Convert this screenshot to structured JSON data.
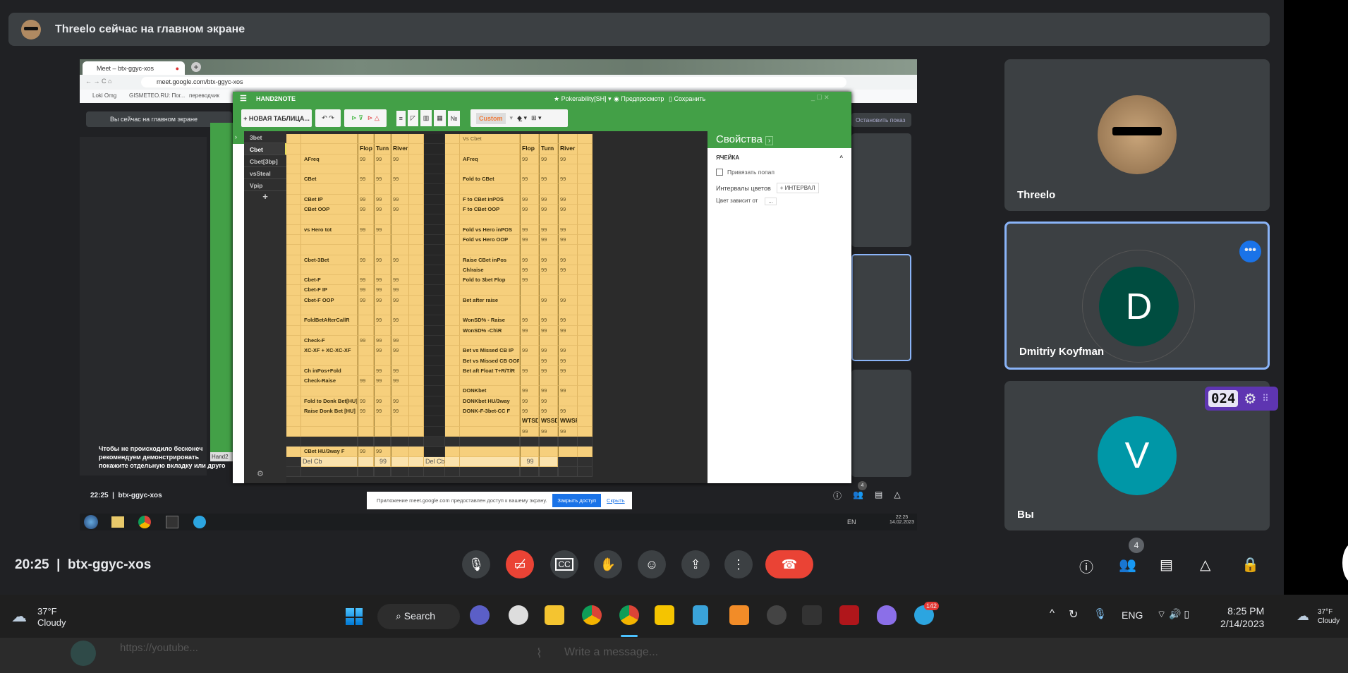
{
  "banner": {
    "text": "Threelo сейчас на главном экране"
  },
  "shared": {
    "chrome": {
      "tab": "Meet – btx-ggyc-xos",
      "url": "meet.google.com/btx-ggyc-xos",
      "bookmarks": [
        "Loki Omg",
        "GISMETEO.RU: Пог...",
        "переводчик"
      ]
    },
    "meet_inner": {
      "presenting": "Вы сейчас на главном экране",
      "stop": "Остановить показ",
      "time": "22:25",
      "code": "btx-ggyc-xos",
      "badge": "4",
      "blurred_text": [
        "Чтобы не происходило бесконеч",
        "рекомендуем демонстрировать",
        "покажите отдельную вкладку или друго"
      ],
      "hand2_tab": "Hand2"
    },
    "notice": {
      "text": "Приложение meet.google.com предоставлен доступ к вашему экрану.",
      "button": "Закрыть доступ",
      "link": "Скрыть"
    },
    "win7": {
      "lang": "EN",
      "time": "22:25",
      "date": "14.02.2023"
    }
  },
  "h2n": {
    "title": "HAND2NOTE",
    "profile": "Pokerability[SH]",
    "preview": "Предпросмотр",
    "save": "Сохранить",
    "new_table": "+ НОВАЯ ТАБЛИЦА...",
    "style": "Custom",
    "tabs": [
      "3bet",
      "Cbet",
      "Cbet[3bp]",
      "vsSteal",
      "Vpip"
    ],
    "active_tab": "Cbet",
    "add_tab": "+",
    "properties": {
      "title": "Свойства",
      "section": "ЯЧЕЙКА",
      "bind_popup": "Привязать попап",
      "intervals": "Интервалы цветов",
      "add_interval": "+ ИНТЕРВАЛ",
      "color_dep": "Цвет зависит от",
      "color_dep_btn": "..."
    },
    "sheet": {
      "rows": [
        {
          "t": "n",
          "v": [
            "",
            "",
            "",
            "",
            "Vs Cbet",
            "",
            "",
            ""
          ]
        },
        {
          "t": "h",
          "v": [
            "",
            "Flop",
            "Turn",
            "River",
            "",
            "Flop",
            "Turn",
            "River"
          ]
        },
        {
          "t": "n",
          "v": [
            "AFreq",
            "99",
            "99",
            "99",
            "AFreq",
            "99",
            "99",
            "99"
          ]
        },
        {
          "t": "n",
          "v": [
            "",
            "",
            "",
            "",
            "",
            "",
            "",
            ""
          ]
        },
        {
          "t": "n",
          "v": [
            "CBet",
            "99",
            "99",
            "99",
            "Fold to CBet",
            "99",
            "99",
            "99"
          ]
        },
        {
          "t": "n",
          "v": [
            "",
            "",
            "",
            "",
            "",
            "",
            "",
            ""
          ]
        },
        {
          "t": "n",
          "v": [
            "CBet IP",
            "99",
            "99",
            "99",
            "F to CBet inPOS",
            "99",
            "99",
            "99"
          ]
        },
        {
          "t": "n",
          "v": [
            "CBet OOP",
            "99",
            "99",
            "99",
            "F to CBet OOP",
            "99",
            "99",
            "99"
          ]
        },
        {
          "t": "n",
          "v": [
            "",
            "",
            "",
            "",
            "",
            "",
            "",
            ""
          ]
        },
        {
          "t": "n",
          "v": [
            "vs Hero tot",
            "99",
            "99",
            "",
            "Fold vs Hero inPOS",
            "99",
            "99",
            "99"
          ]
        },
        {
          "t": "n",
          "v": [
            "",
            "",
            "",
            "",
            "Fold vs Hero OOP",
            "99",
            "99",
            "99"
          ]
        },
        {
          "t": "n",
          "v": [
            "",
            "",
            "",
            "",
            "",
            "",
            "",
            ""
          ]
        },
        {
          "t": "n",
          "v": [
            "Cbet-3Bet",
            "99",
            "99",
            "99",
            "Raise CBet inPos",
            "99",
            "99",
            "99"
          ]
        },
        {
          "t": "n",
          "v": [
            "",
            "",
            "",
            "",
            "Ch/raise",
            "99",
            "99",
            "99"
          ]
        },
        {
          "t": "n",
          "v": [
            "Cbet-F",
            "99",
            "99",
            "99",
            "Fold to 3bet Flop",
            "99",
            "",
            ""
          ]
        },
        {
          "t": "n",
          "v": [
            "Cbet-F IP",
            "99",
            "99",
            "99",
            "",
            "",
            "",
            ""
          ]
        },
        {
          "t": "n",
          "v": [
            "Cbet-F OOP",
            "99",
            "99",
            "99",
            "Bet after raise",
            "",
            "99",
            "99"
          ]
        },
        {
          "t": "n",
          "v": [
            "",
            "",
            "",
            "",
            "",
            "",
            "",
            ""
          ]
        },
        {
          "t": "n",
          "v": [
            "FoldBetAfterCallR",
            "",
            "99",
            "99",
            "WonSD% - Raise",
            "99",
            "99",
            "99"
          ]
        },
        {
          "t": "n",
          "v": [
            "",
            "",
            "",
            "",
            "WonSD% -Ch\\R",
            "99",
            "99",
            "99"
          ]
        },
        {
          "t": "n",
          "v": [
            "Check-F",
            "99",
            "99",
            "99",
            "",
            "",
            "",
            ""
          ]
        },
        {
          "t": "n",
          "v": [
            "XC-XF + XC-XC-XF",
            "",
            "99",
            "99",
            "Bet vs Missed CB IP",
            "99",
            "99",
            "99"
          ]
        },
        {
          "t": "n",
          "v": [
            "",
            "",
            "",
            "",
            "Bet vs Missed CB OOP",
            "",
            "99",
            "99"
          ]
        },
        {
          "t": "n",
          "v": [
            "Ch inPos+Fold",
            "",
            "99",
            "99",
            "Bet aft Float T+R/T/R",
            "99",
            "99",
            "99"
          ]
        },
        {
          "t": "n",
          "v": [
            "Check-Raise",
            "99",
            "99",
            "99",
            "",
            "",
            "",
            ""
          ]
        },
        {
          "t": "n",
          "v": [
            "",
            "",
            "",
            "",
            "DONKbet",
            "99",
            "99",
            "99"
          ]
        },
        {
          "t": "n",
          "v": [
            "Fold to Donk Bet[HU]",
            "99",
            "99",
            "99",
            "DONKbet HU/3way",
            "99",
            "99",
            ""
          ]
        },
        {
          "t": "n",
          "v": [
            "Raise Donk Bet [HU]",
            "99",
            "99",
            "99",
            "DONK-F-3bet-CC F",
            "99",
            "99",
            "99"
          ]
        },
        {
          "t": "h",
          "v": [
            "",
            "",
            "",
            "",
            "",
            "WTSD",
            "WSSD",
            "WWSF"
          ]
        },
        {
          "t": "n",
          "v": [
            "",
            "",
            "",
            "",
            "",
            "99",
            "99",
            "99"
          ]
        },
        {
          "t": "d",
          "v": [
            "",
            "",
            "",
            "",
            "",
            "",
            "",
            ""
          ]
        },
        {
          "t": "n",
          "v": [
            "CBet HU/3way F",
            "99",
            "99",
            "",
            "",
            "",
            "",
            ""
          ]
        },
        {
          "t": "x",
          "v": [
            "Del Cb",
            "",
            "99",
            "",
            "Del Cb",
            "99",
            "",
            ""
          ]
        },
        {
          "t": "d",
          "v": [
            "",
            "",
            "",
            "",
            "",
            "",
            "",
            ""
          ]
        }
      ]
    }
  },
  "participants": [
    {
      "name": "Threelo"
    },
    {
      "name": "Dmitriy Koyfman",
      "initial": "D",
      "color": "#004d40"
    },
    {
      "name": "Вы",
      "initial": "V",
      "color": "#0097a7"
    }
  ],
  "timer": {
    "value": "024"
  },
  "controls": {
    "time": "20:25",
    "code": "btx-ggyc-xos",
    "people_count": "4",
    "buttons": [
      "mic-icon",
      "camera-off-icon",
      "captions-icon",
      "raise-hand-icon",
      "emoji-icon",
      "present-icon",
      "more-icon",
      "hangup-icon"
    ]
  },
  "taskbar": {
    "weather_temp": "37°F",
    "weather_desc": "Cloudy",
    "search": "Search",
    "lang": "ENG",
    "time": "8:25 PM",
    "date": "2/14/2023",
    "telegram_badge": "142"
  },
  "behind": {
    "link": "https://youtube...",
    "message_placeholder": "Write a message..."
  },
  "colors": {
    "meet_bg": "#202124",
    "tile": "#3c4043",
    "h2n_green": "#43a047",
    "cell_yellow": "#f6cf7c",
    "hangup": "#ea4335",
    "active_border": "#8ab4f8"
  }
}
